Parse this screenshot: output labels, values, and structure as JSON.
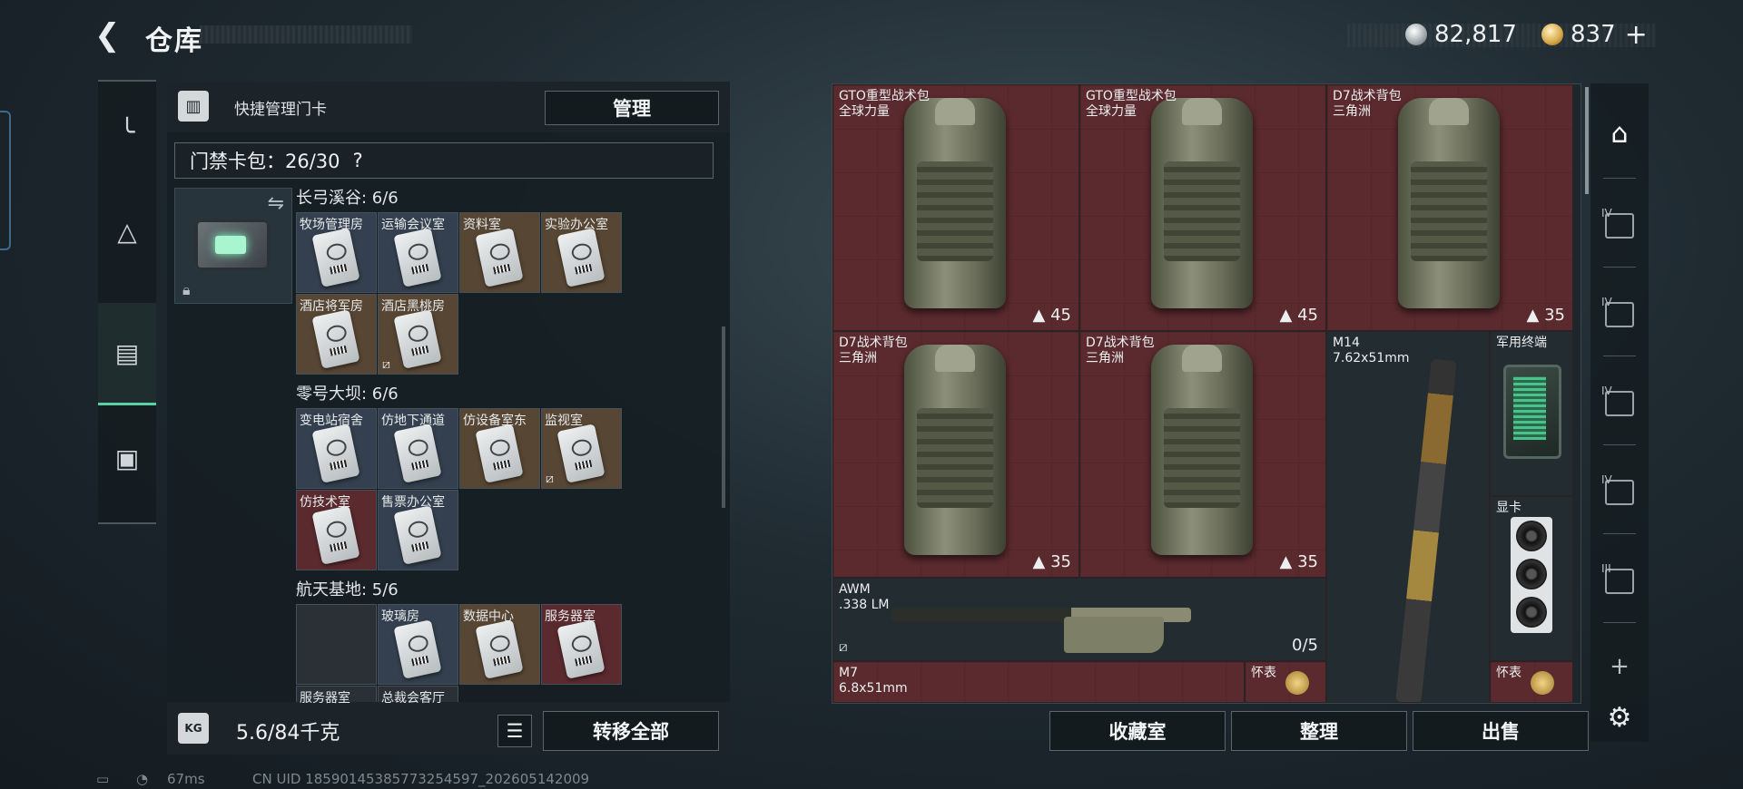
{
  "header": {
    "back_icon": "back-arrow-icon",
    "title": "仓库",
    "currency_silver": "82,817",
    "currency_gold": "837",
    "plus": "+"
  },
  "left_nav": {
    "items": [
      {
        "icon": "pistol-icon"
      },
      {
        "icon": "vest-icon"
      },
      {
        "icon": "keycard-bag-icon",
        "active": true
      },
      {
        "icon": "briefcase-icon"
      }
    ]
  },
  "keycard_panel": {
    "head_label": "快捷管理门卡",
    "manage_button": "管理",
    "bag_label": "门禁卡包：26/30",
    "help": "?",
    "swap_icon": "⇋",
    "groups": [
      {
        "title": "长弓溪谷: 6/6",
        "cards": [
          {
            "label": "牧场管理房",
            "color": "blue",
            "broken": false
          },
          {
            "label": "运输会议室",
            "color": "blue",
            "broken": false
          },
          {
            "label": "资料室",
            "color": "brown",
            "broken": false
          },
          {
            "label": "实验办公室",
            "color": "brown",
            "broken": false
          },
          {
            "label": "酒店将军房",
            "color": "brown",
            "broken": false
          },
          {
            "label": "酒店黑桃房",
            "color": "brown",
            "broken": true
          }
        ]
      },
      {
        "title": "零号大坝: 6/6",
        "cards": [
          {
            "label": "变电站宿舍",
            "color": "blue",
            "broken": false
          },
          {
            "label": "仿地下通道",
            "color": "blue",
            "broken": false
          },
          {
            "label": "仿设备室东",
            "color": "brown",
            "broken": false
          },
          {
            "label": "监视室",
            "color": "brown",
            "broken": true
          },
          {
            "label": "仿技术室",
            "color": "red",
            "broken": false
          },
          {
            "label": "售票办公室",
            "color": "blue",
            "broken": false
          }
        ]
      },
      {
        "title": "航天基地: 5/6",
        "cards": [
          {
            "label": "",
            "color": "dark",
            "broken": false
          },
          {
            "label": "玻璃房",
            "color": "blue",
            "broken": false
          },
          {
            "label": "数据中心",
            "color": "brown",
            "broken": false
          },
          {
            "label": "服务器室",
            "color": "red",
            "broken": false
          },
          {
            "label": "服务器室",
            "color": "dark",
            "broken": false
          },
          {
            "label": "总裁会客厅",
            "color": "dark",
            "broken": false
          }
        ]
      }
    ],
    "weight": "5.6/84千克",
    "weight_icon_text": "KG",
    "transfer_button": "转移全部"
  },
  "storage": {
    "tiles": [
      {
        "name": "GTO重型战术包",
        "sub": "全球力量",
        "count": "45",
        "kind": "backpack"
      },
      {
        "name": "GTO重型战术包",
        "sub": "全球力量",
        "count": "45",
        "kind": "backpack"
      },
      {
        "name": "D7战术背包",
        "sub": "三角洲",
        "count": "35",
        "kind": "backpack"
      },
      {
        "name": "D7战术背包",
        "sub": "三角洲",
        "count": "35",
        "kind": "backpack"
      },
      {
        "name": "D7战术背包",
        "sub": "三角洲",
        "count": "35",
        "kind": "backpack"
      },
      {
        "name": "M14",
        "sub": "7.62x51mm",
        "count": "",
        "kind": "rifle"
      },
      {
        "name": "军用终端",
        "sub": "",
        "count": "",
        "kind": "terminal"
      },
      {
        "name": "显卡",
        "sub": "",
        "count": "",
        "kind": "gpu"
      },
      {
        "name": "AWM",
        "sub": ".338 LM",
        "count": "0/5",
        "kind": "sniper"
      },
      {
        "name": "M7",
        "sub": "6.8x51mm",
        "count": "",
        "kind": "rifle"
      },
      {
        "name": "怀表",
        "sub": "",
        "count": "",
        "kind": "watch"
      },
      {
        "name": "怀表",
        "sub": "",
        "count": "",
        "kind": "watch"
      }
    ],
    "buttons": [
      "收藏室",
      "整理",
      "出售"
    ]
  },
  "right_nav": {
    "items": [
      {
        "level": "",
        "icon": "home-icon"
      },
      {
        "level": "IV",
        "icon": "med-kit-icon"
      },
      {
        "level": "IV",
        "icon": "first-aid-plus-icon"
      },
      {
        "level": "IV",
        "icon": "med-kit-icon"
      },
      {
        "level": "IV",
        "icon": "bag-icon"
      },
      {
        "level": "III",
        "icon": "armor-icon"
      },
      {
        "level": "",
        "icon": "plus-icon"
      },
      {
        "level": "",
        "icon": "gear-icon"
      }
    ]
  },
  "status_bar": {
    "ping": "67ms",
    "uid": "CN UID 1859014538577325459​7_202605142009"
  }
}
